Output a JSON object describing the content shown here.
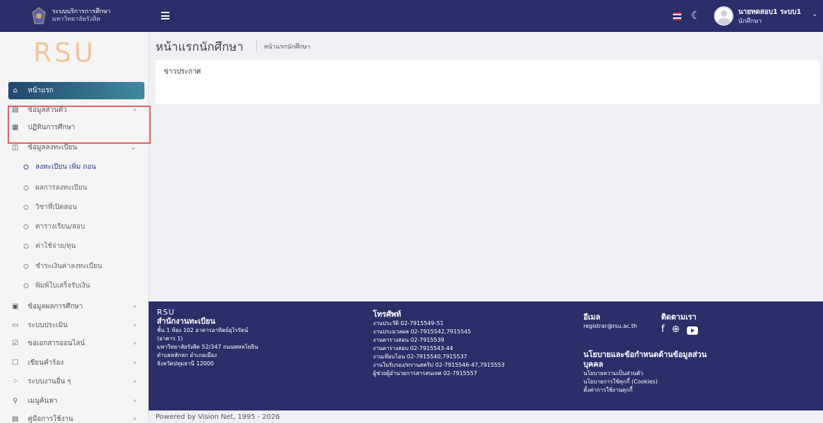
{
  "brand": {
    "line1": "ระบบบริการการศึกษา",
    "line2": "มหาวิทยาลัยรังสิต"
  },
  "logo_text": "RSU",
  "user": {
    "name": "นายทดสอบ1 ระบบ1",
    "role": "นักศึกษา"
  },
  "sidebar": {
    "items": [
      {
        "label": "หน้าแรก",
        "icon": "home-icon"
      },
      {
        "label": "ข้อมูลส่วนตัว",
        "icon": "id-card-icon"
      },
      {
        "label": "ปฏิทินการศึกษา",
        "icon": "calendar-icon"
      },
      {
        "label": "ข้อมูลลงทะเบียน",
        "icon": "register-icon"
      },
      {
        "label": "ข้อมูลผลการศึกษา",
        "icon": "book-icon"
      },
      {
        "label": "ระบบประเมิน",
        "icon": "clipboard-icon"
      },
      {
        "label": "ขอเอกสารออนไลน์",
        "icon": "document-check-icon"
      },
      {
        "label": "เขียนคำร้อง",
        "icon": "edit-document-icon"
      },
      {
        "label": "ระบบงานอื่น ๆ",
        "icon": "grid-icon"
      },
      {
        "label": "เมนูค้นหา",
        "icon": "search-icon"
      },
      {
        "label": "คู่มือการใช้งาน",
        "icon": "manual-icon"
      }
    ],
    "sub_items": [
      "ลงทะเบียน เพิ่ม ถอน",
      "ผลการลงทะเบียน",
      "วิชาที่เปิดสอน",
      "ตารางเรียน/สอบ",
      "ค่าใช้จ่าย/ทุน",
      "ชำระเงินค่าลงทะเบียน",
      "พิมพ์ใบเสร็จรับเงิน"
    ]
  },
  "main": {
    "title": "หน้าแรกนักศึกษา",
    "breadcrumb": "หน้าแรกนักศึกษา",
    "card_title": "ข่าวประกาศ"
  },
  "footer": {
    "logo": "RSU",
    "office_title": "สำนักงานทะเบียน",
    "address": [
      "ชั้น 1 ห้อง 102 อาคารอาทิตย์อุไรรัตน์",
      "(อาคาร 1)",
      "มหาวิทยาลัยรังสิต 52/347 ถนนพหลโยธิน",
      "ตำบลหลักหก อำเภอเมือง",
      "จังหวัดปทุมธานี 12000"
    ],
    "phone_title": "โทรศัพท์",
    "phones": [
      "งานประวัติ 02-7915549-51",
      "งานประมวลผล 02-7915542,7915545",
      "งานตารางสอน 02-7915539",
      "งานตารางสอบ 02-7915543-44",
      "งานเทียบโอน 02-7915540,7915537",
      "งานใบรับรอง/ทรานสคริป 02-7915546-47,7915553",
      "ผู้ช่วยผู้อำนวยการสารสนเทศ 02-7915557"
    ],
    "email_title": "อีเมล",
    "email": "registrar@rsu.ac.th",
    "follow_title": "ติดตามเรา",
    "policy_title_1": "นโยบายและข้อกำหนดด้านข้อมูลส่วน",
    "policy_title_2": "บุคคล",
    "policies": [
      "นโยบายความเป็นส่วนตัว",
      "นโยบายการใช้คุกกี้ (Cookies)",
      "ตั้งค่าการใช้งานคุกกี้"
    ]
  },
  "powered": "Powered by Vision Net, 1995 - 2026",
  "colors": {
    "topbar": "#2a2f6a",
    "active_menu": "#22476e",
    "highlight": "#e06060",
    "logo": "#f1c69a"
  }
}
